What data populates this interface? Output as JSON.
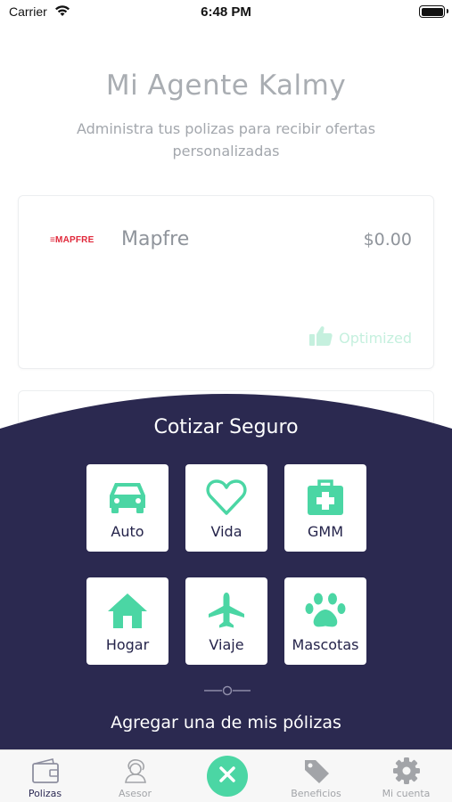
{
  "status_bar": {
    "carrier": "Carrier",
    "time": "6:48 PM"
  },
  "header": {
    "title": "Mi Agente Kalmy",
    "subtitle": "Administra tus polizas para recibir ofertas personalizadas"
  },
  "policy": {
    "logo_text": "≡MAPFRE",
    "insurer": "Mapfre",
    "price": "$0.00",
    "status": "Optimized",
    "status_icon": "thumbs-up-icon"
  },
  "quote": {
    "title": "Cotizar Seguro",
    "options": [
      {
        "label": "Auto",
        "icon": "car-icon"
      },
      {
        "label": "Vida",
        "icon": "heart-icon"
      },
      {
        "label": "GMM",
        "icon": "medical-kit-icon"
      },
      {
        "label": "Hogar",
        "icon": "house-icon"
      },
      {
        "label": "Viaje",
        "icon": "airplane-icon"
      },
      {
        "label": "Mascotas",
        "icon": "paw-icon"
      }
    ],
    "add_policy": "Agregar una de mis pólizas"
  },
  "tabs": [
    {
      "label": "Polizas",
      "icon": "wallet-icon",
      "active": true
    },
    {
      "label": "Asesor",
      "icon": "advisor-icon",
      "active": false
    },
    {
      "label": "",
      "icon": "close-icon",
      "active": false
    },
    {
      "label": "Beneficios",
      "icon": "tag-icon",
      "active": false
    },
    {
      "label": "Mi cuenta",
      "icon": "gear-icon",
      "active": false
    }
  ],
  "colors": {
    "accent": "#4bd6a4",
    "panel": "#2b2950",
    "optimized": "#c5f0de",
    "brand_logo": "#e0283a"
  }
}
